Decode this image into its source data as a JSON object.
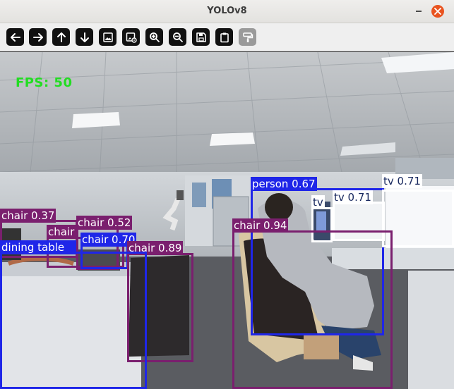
{
  "window": {
    "title": "YOLOv8"
  },
  "toolbar": {
    "buttons": [
      {
        "name": "back-button",
        "icon": "arrow-left-icon"
      },
      {
        "name": "forward-button",
        "icon": "arrow-right-icon"
      },
      {
        "name": "up-button",
        "icon": "arrow-up-icon"
      },
      {
        "name": "down-button",
        "icon": "arrow-down-icon"
      },
      {
        "name": "open-image-button",
        "icon": "image-icon"
      },
      {
        "name": "image-settings-button",
        "icon": "image-gear-icon"
      },
      {
        "name": "zoom-in-button",
        "icon": "zoom-in-icon"
      },
      {
        "name": "zoom-out-button",
        "icon": "zoom-out-icon"
      },
      {
        "name": "save-button",
        "icon": "save-icon"
      },
      {
        "name": "clipboard-button",
        "icon": "clipboard-icon"
      },
      {
        "name": "paint-button",
        "icon": "paint-roller-icon",
        "disabled": true
      }
    ]
  },
  "overlay": {
    "fps": "FPS: 50"
  },
  "detections": [
    {
      "label": "person 0.67",
      "class": "person",
      "confidence": 0.67,
      "color": "#1f26e8"
    },
    {
      "label": "tv 0.71",
      "class": "tv",
      "confidence": 0.71,
      "color": "#ffffff"
    },
    {
      "label": "tv 0.71",
      "class": "tv",
      "confidence": 0.71,
      "color": "#ffffff"
    },
    {
      "label": "tv",
      "class": "tv",
      "color": "#ffffff"
    },
    {
      "label": "chair 0.94",
      "class": "chair",
      "confidence": 0.94,
      "color": "#7a1f6e"
    },
    {
      "label": "chair 0.37",
      "class": "chair",
      "confidence": 0.37,
      "color": "#7a1f6e"
    },
    {
      "label": "chair 0.52",
      "class": "chair",
      "confidence": 0.52,
      "color": "#7a1f6e"
    },
    {
      "label": "chair 0.70",
      "class": "chair",
      "confidence": 0.7,
      "color": "#7a1f6e"
    },
    {
      "label": "chair 0.89",
      "class": "chair",
      "confidence": 0.89,
      "color": "#7a1f6e"
    },
    {
      "label": "chair",
      "class": "chair",
      "color": "#7a1f6e"
    },
    {
      "label": "dining table",
      "class": "dining table",
      "color": "#1f26e8"
    }
  ]
}
